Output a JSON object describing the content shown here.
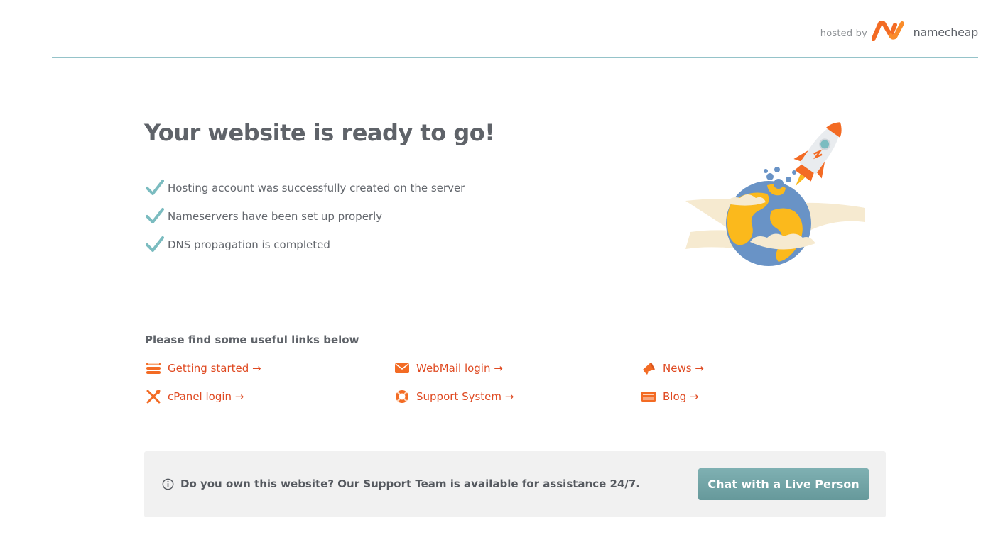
{
  "header": {
    "hosted_by": "hosted by",
    "brand_name": "namecheap",
    "brand_color": "#f36b24",
    "divider_color": "#95c3c9"
  },
  "main": {
    "title": "Your website is ready to go!",
    "checklist": [
      {
        "icon": "check-icon",
        "text": "Hosting account was successfully created on the server"
      },
      {
        "icon": "check-icon",
        "text": "Nameservers have been set up properly"
      },
      {
        "icon": "check-icon",
        "text": "DNS propagation is completed"
      }
    ],
    "check_color": "#7bbcc0"
  },
  "links": {
    "heading": "Please find some useful links below",
    "link_color": "#df4a22",
    "items": [
      {
        "icon": "server-stack-icon",
        "label": "Getting started →"
      },
      {
        "icon": "mail-icon",
        "label": "WebMail login →"
      },
      {
        "icon": "megaphone-icon",
        "label": "News →"
      },
      {
        "icon": "tools-icon",
        "label": "cPanel login →"
      },
      {
        "icon": "lifebuoy-icon",
        "label": "Support System →"
      },
      {
        "icon": "blog-window-icon",
        "label": "Blog →"
      }
    ]
  },
  "support": {
    "message": "Do you own this website? Our Support Team is available for assistance 24/7.",
    "chat_button": "Chat with a Live Person",
    "button_color": "#6fa3a5"
  }
}
